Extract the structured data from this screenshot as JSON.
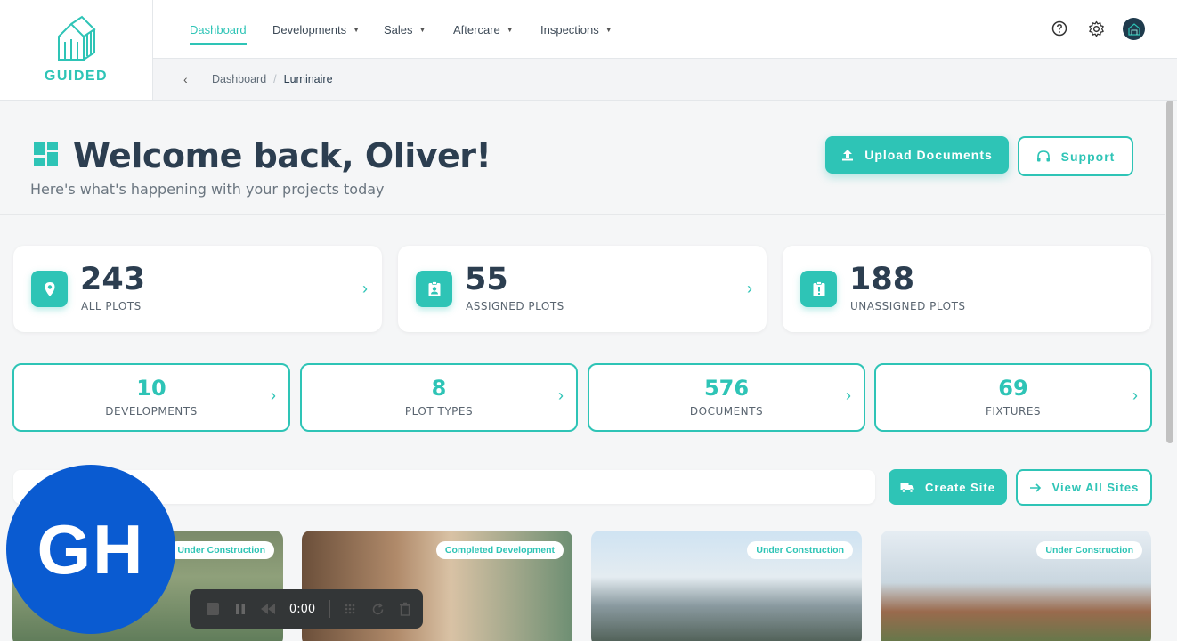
{
  "logo": {
    "text": "GUIDED"
  },
  "nav": {
    "items": [
      {
        "label": "Dashboard",
        "active": true
      },
      {
        "label": "Developments"
      },
      {
        "label": "Sales"
      },
      {
        "label": "Aftercare"
      },
      {
        "label": "Inspections"
      }
    ]
  },
  "breadcrumb": {
    "root": "Dashboard",
    "current": "Luminaire"
  },
  "welcome": {
    "title": "Welcome back, Oliver!",
    "subtitle": "Here's what's happening with your projects today",
    "upload_label": "Upload Documents",
    "support_label": "Support"
  },
  "stats": [
    {
      "value": "243",
      "label": "ALL PLOTS",
      "icon": "map-pin-icon"
    },
    {
      "value": "55",
      "label": "ASSIGNED PLOTS",
      "icon": "badge-icon"
    },
    {
      "value": "188",
      "label": "UNASSIGNED PLOTS",
      "icon": "alert-clipboard-icon"
    }
  ],
  "counts": [
    {
      "value": "10",
      "label": "DEVELOPMENTS"
    },
    {
      "value": "8",
      "label": "PLOT TYPES"
    },
    {
      "value": "576",
      "label": "DOCUMENTS"
    },
    {
      "value": "69",
      "label": "FIXTURES"
    }
  ],
  "sites_actions": {
    "create_label": "Create Site",
    "view_label": "View All Sites"
  },
  "sites": [
    {
      "badge": "Under Construction"
    },
    {
      "badge": "Completed Development"
    },
    {
      "badge": "Under Construction"
    },
    {
      "badge": "Under Construction"
    }
  ],
  "overlay": {
    "avatar_initials": "GH",
    "recorder_time": "0:00"
  },
  "colors": {
    "accent": "#2ec4b6",
    "text": "#2c3e50",
    "overlay_blue": "#0a5bd1"
  }
}
